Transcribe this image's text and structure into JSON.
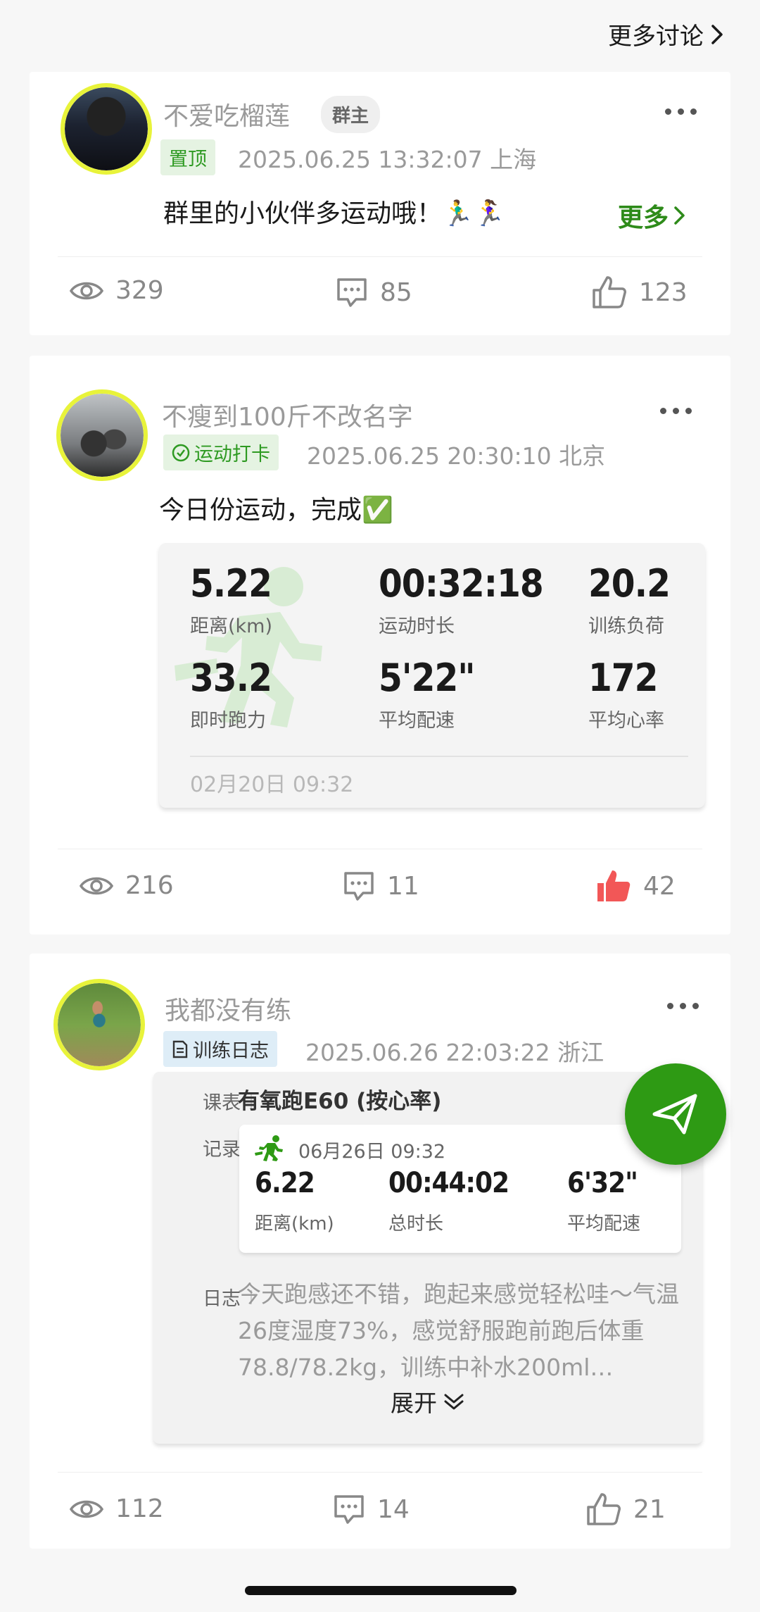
{
  "header": {
    "more_discussion": "更多讨论"
  },
  "posts": [
    {
      "author": "不爱吃榴莲",
      "role_badge": "群主",
      "tag": "置顶",
      "datetime": "2025.06.25  13:32:07  上海",
      "text": "群里的小伙伴多运动哦！🏃‍♂️🏃‍♀️",
      "more_label": "更多",
      "views": "329",
      "comments": "85",
      "likes": "123",
      "liked": false
    },
    {
      "author": "不瘦到100斤不改名字",
      "tag": "运动打卡",
      "datetime": "2025.06.25  20:30:10  北京",
      "text": "今日份运动，完成✅",
      "workout": {
        "distance": "5.22",
        "distance_label": "距离(km)",
        "duration": "00:32:18",
        "duration_label": "运动时长",
        "load": "20.2",
        "load_label": "训练负荷",
        "power": "33.2",
        "power_label": "即时跑力",
        "pace": "5'22\"",
        "pace_label": "平均配速",
        "hr": "172",
        "hr_label": "平均心率",
        "date": "02月20日 09:32"
      },
      "views": "216",
      "comments": "11",
      "likes": "42",
      "liked": true
    },
    {
      "author": "我都没有练",
      "tag": "训练日志",
      "datetime": "2025.06.26  22:03:22  浙江",
      "log": {
        "plan_label": "课表",
        "plan": "有氧跑E60 (按心率)",
        "record_label": "记录",
        "record_date": "06月26日 09:32",
        "distance": "6.22",
        "distance_label": "距离(km)",
        "duration": "00:44:02",
        "duration_label": "总时长",
        "pace": "6'32\"",
        "pace_label": "平均配速",
        "journal_label": "日志",
        "journal": "今天跑感还不错，跑起来感觉轻松哇～气温26度湿度73%，感觉舒服跑前跑后体重78.8/78.2kg，训练中补水200ml…",
        "expand_label": "展开"
      },
      "views": "112",
      "comments": "14",
      "likes": "21",
      "liked": false
    }
  ],
  "colors": {
    "accent_green": "#2e9a14",
    "like_red": "#f25757",
    "avatar_ring": "#e8f33a"
  }
}
